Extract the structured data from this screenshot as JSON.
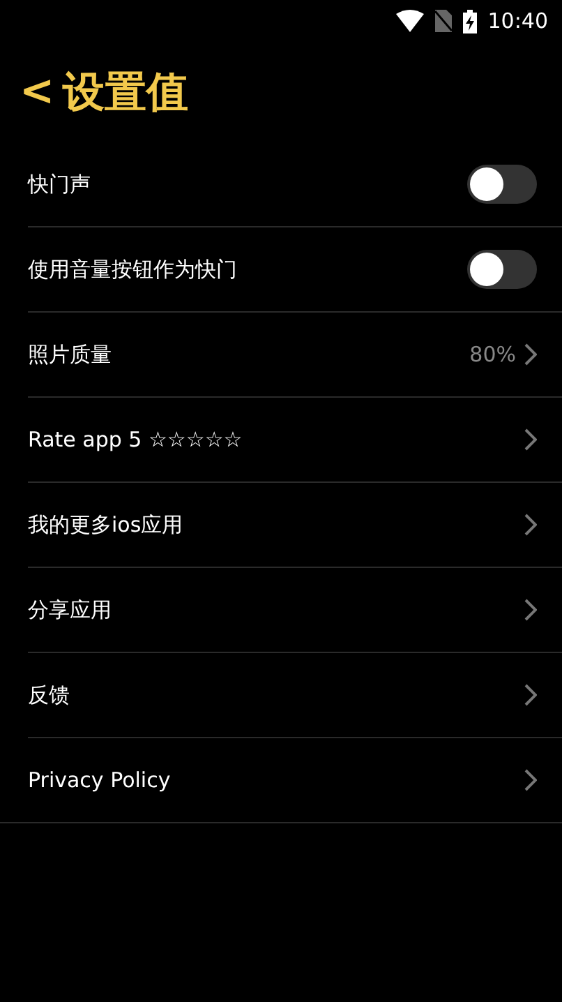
{
  "status_bar": {
    "time": "10:40"
  },
  "header": {
    "back": "<",
    "title": "设置值"
  },
  "items": [
    {
      "kind": "toggle",
      "label": "快门声",
      "on": false
    },
    {
      "kind": "toggle",
      "label": "使用音量按钮作为快门",
      "on": false
    },
    {
      "kind": "link",
      "label": "照片质量",
      "value": "80%"
    },
    {
      "kind": "link",
      "label": "Rate app 5 ☆☆☆☆☆"
    },
    {
      "kind": "link",
      "label": "我的更多ios应用"
    },
    {
      "kind": "link",
      "label": "分享应用"
    },
    {
      "kind": "link",
      "label": "反馈"
    },
    {
      "kind": "link",
      "label": "Privacy Policy"
    }
  ]
}
